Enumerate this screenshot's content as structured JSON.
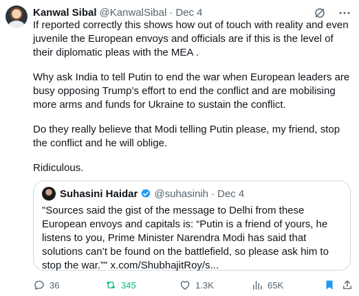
{
  "tweet": {
    "author_name": "Kanwal Sibal",
    "author_handle": "@KanwalSibal",
    "separator": "·",
    "date": "Dec 4",
    "paragraphs": [
      "If reported correctly this shows how out of touch with reality and even juvenile the European envoys and officials are if this is the level of their diplomatic pleas with  the MEA .",
      "Why ask India to tell Putin to end the war when European leaders are busy opposing Trump’s effort to end the conflict and are mobilising more arms and funds for Ukraine to sustain the conflict.",
      "Do they really believe that Modi telling Putin please, my friend, stop the conflict and he will oblige.",
      "Ridiculous."
    ]
  },
  "quote": {
    "author_name": "Suhasini Haidar",
    "author_handle": "@suhasinih",
    "separator": "·",
    "date": "Dec 4",
    "text": "\"Sources said the gist of the message to Delhi from these European envoys and capitals is: “Putin is a friend of yours, he listens to you, Prime Minister Narendra Modi has said that solutions can’t be found on the battlefield, so please ask him to stop the war.”\" x.com/ShubhajitRoy/s..."
  },
  "actions": {
    "replies": "36",
    "reposts": "345",
    "likes": "1.3K",
    "views": "65K"
  },
  "colors": {
    "text": "#0f1419",
    "muted": "#536471",
    "repost_active": "#00ba7c",
    "bookmark_active": "#1d9bf0",
    "verified": "#1d9bf0",
    "border": "#cfd9de"
  },
  "icons": [
    "grok-icon",
    "more-icon",
    "verified-icon",
    "reply-icon",
    "repost-icon",
    "like-icon",
    "views-icon",
    "bookmark-icon",
    "share-icon"
  ]
}
